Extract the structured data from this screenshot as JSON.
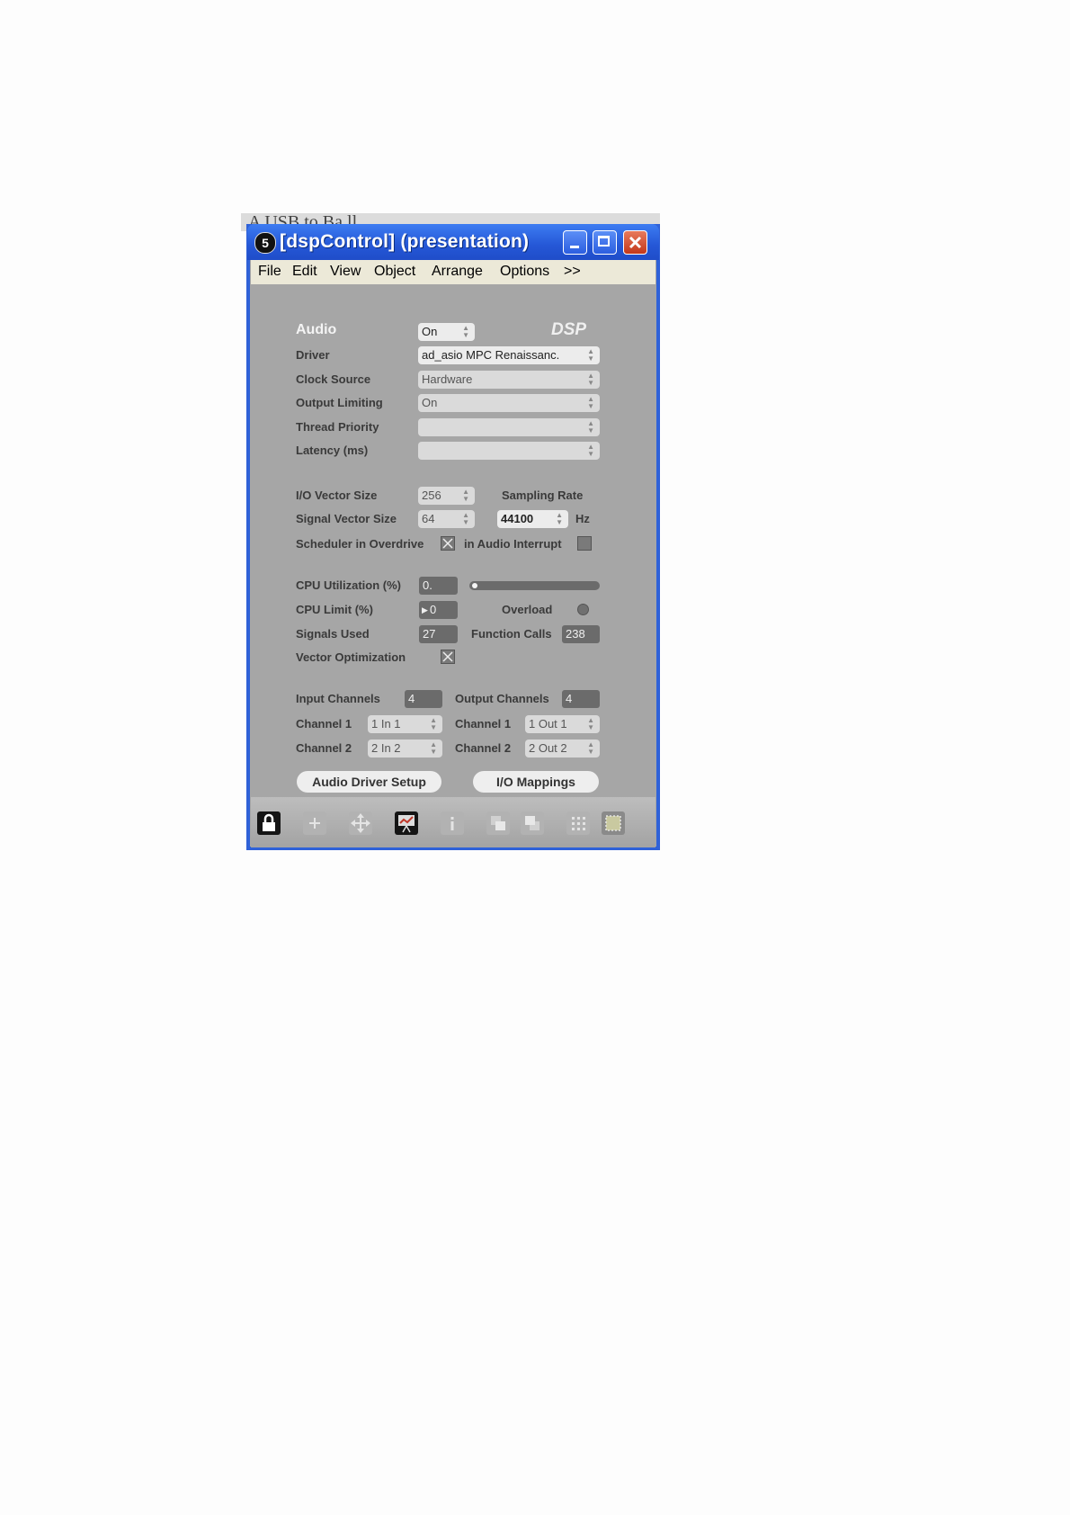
{
  "background_doc": {
    "text": "A USB to Ba ll"
  },
  "window": {
    "icon_text": "5",
    "title": "[dspControl] (presentation)"
  },
  "menu": [
    "File",
    "Edit",
    "View",
    "Object",
    "Arrange",
    "Options",
    ">>"
  ],
  "audio_section": {
    "audio_label": "Audio",
    "audio_value": "On",
    "dsp_label": "DSP",
    "driver_label": "Driver",
    "driver_value": "ad_asio MPC Renaissanc.",
    "clock_label": "Clock Source",
    "clock_value": "Hardware",
    "output_limiting_label": "Output Limiting",
    "output_limiting_value": "On",
    "thread_priority_label": "Thread Priority",
    "thread_priority_value": "",
    "latency_label": "Latency (ms)",
    "latency_value": ""
  },
  "vector_section": {
    "io_vector_label": "I/O Vector Size",
    "io_vector_value": "256",
    "sampling_rate_label": "Sampling Rate",
    "signal_vector_label": "Signal Vector Size",
    "signal_vector_value": "64",
    "sampling_rate_value": "44100",
    "hz_label": "Hz",
    "scheduler_label": "Scheduler in Overdrive",
    "scheduler_checked": true,
    "interrupt_label": "in Audio Interrupt",
    "interrupt_checked": false
  },
  "cpu_section": {
    "cpu_util_label": "CPU Utilization (%)",
    "cpu_util_value": "0.",
    "cpu_util_level": 0.02,
    "cpu_limit_label": "CPU Limit (%)",
    "cpu_limit_value": "0",
    "overload_label": "Overload",
    "signals_label": "Signals Used",
    "signals_value": "27",
    "function_calls_label": "Function Calls",
    "function_calls_value": "238",
    "vector_opt_label": "Vector Optimization",
    "vector_opt_checked": true
  },
  "channels_section": {
    "input_channels_label": "Input Channels",
    "input_channels_value": "4",
    "output_channels_label": "Output Channels",
    "output_channels_value": "4",
    "in_ch1_label": "Channel 1",
    "in_ch1_value": "1 In 1",
    "out_ch1_label": "Channel 1",
    "out_ch1_value": "1 Out 1",
    "in_ch2_label": "Channel 2",
    "in_ch2_value": "2 In 2",
    "out_ch2_label": "Channel 2",
    "out_ch2_value": "2 Out 2"
  },
  "buttons": {
    "driver_setup": "Audio Driver Setup",
    "io_mappings": "I/O Mappings"
  },
  "toolbar_icons": [
    "lock-icon",
    "add-icon",
    "move-icon",
    "presentation-icon",
    "info-icon",
    "bring-front-icon",
    "send-back-icon",
    "grid-icon",
    "snap-icon"
  ]
}
